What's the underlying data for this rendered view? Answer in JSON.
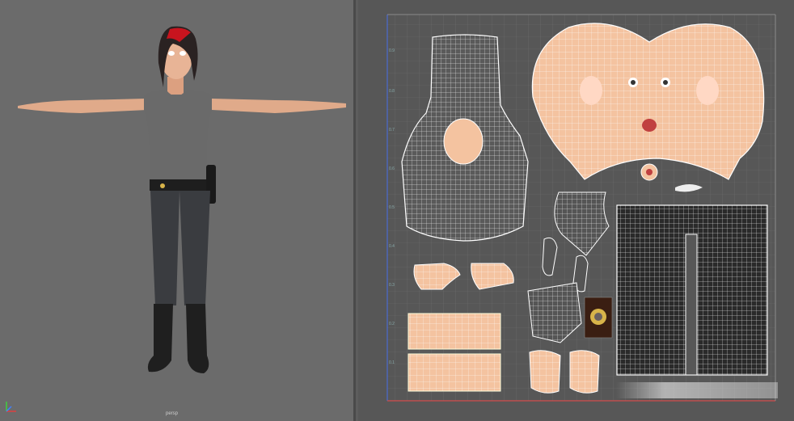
{
  "viewport": {
    "camera_label": "persp",
    "character": "female-character-t-pose"
  },
  "uv_editor": {
    "tick_labels": [
      "0.9",
      "0.8",
      "0.7",
      "0.6",
      "0.5",
      "0.4",
      "0.3",
      "0.2",
      "0.1"
    ],
    "shells": [
      "torso-back-shell",
      "head-shell",
      "badge-shell",
      "pants-shell",
      "hand-shells",
      "arm-shells",
      "ear-shell"
    ]
  },
  "colors": {
    "viewport_bg": "#6b6b6b",
    "uv_bg": "#575757",
    "skin": "#f4c3a0",
    "wire_grid": "#ffffff",
    "hair_red": "#c8141e"
  }
}
